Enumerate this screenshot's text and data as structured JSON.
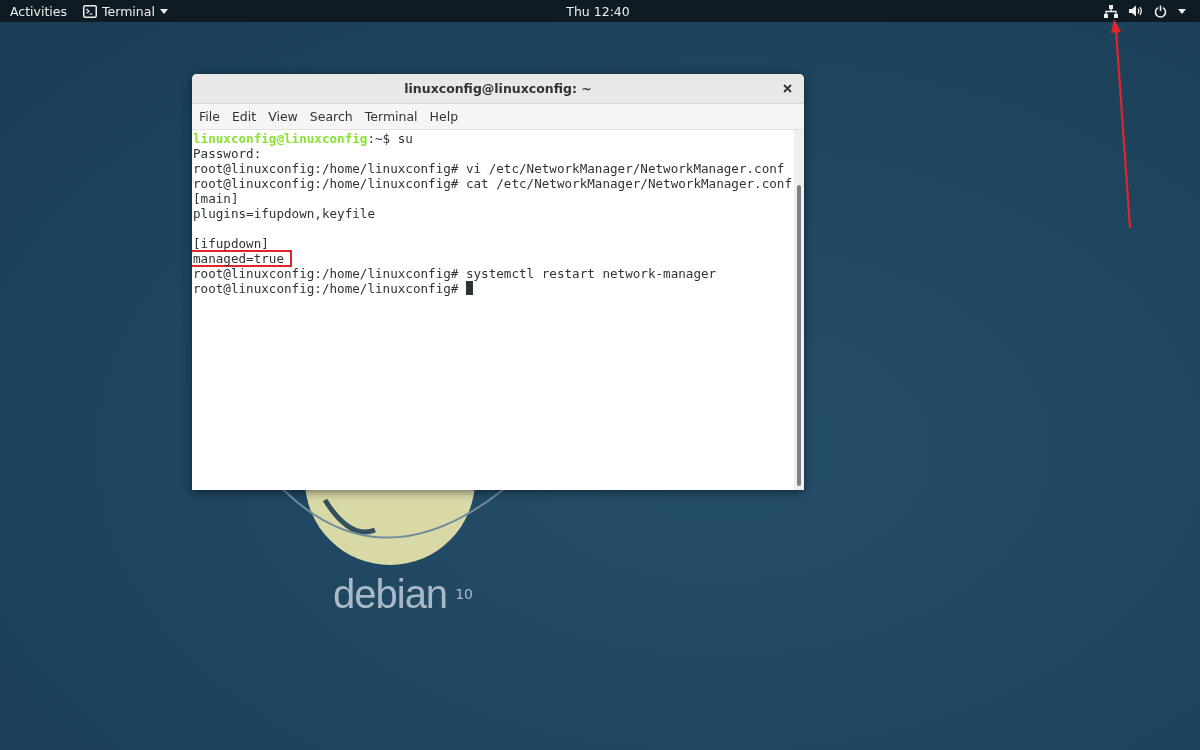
{
  "top_bar": {
    "activities": "Activities",
    "app_menu": "Terminal",
    "clock": "Thu 12:40"
  },
  "desktop": {
    "logo_text": "debian",
    "logo_version": "10"
  },
  "terminal": {
    "title": "linuxconfig@linuxconfig: ~",
    "menu": [
      "File",
      "Edit",
      "View",
      "Search",
      "Terminal",
      "Help"
    ],
    "lines": [
      {
        "kind": "user_prompt",
        "user": "linuxconfig@linuxconfig",
        "text": ":~$ su",
        "highlighted": false,
        "cursor": false
      },
      {
        "kind": "plain",
        "text": "Password:",
        "highlighted": false,
        "cursor": false
      },
      {
        "kind": "plain",
        "text": "root@linuxconfig:/home/linuxconfig# vi /etc/NetworkManager/NetworkManager.conf",
        "highlighted": false,
        "cursor": false
      },
      {
        "kind": "plain",
        "text": "root@linuxconfig:/home/linuxconfig# cat /etc/NetworkManager/NetworkManager.conf",
        "highlighted": false,
        "cursor": false
      },
      {
        "kind": "plain",
        "text": "[main]",
        "highlighted": false,
        "cursor": false
      },
      {
        "kind": "plain",
        "text": "plugins=ifupdown,keyfile",
        "highlighted": false,
        "cursor": false
      },
      {
        "kind": "blank"
      },
      {
        "kind": "plain",
        "text": "[ifupdown]",
        "highlighted": false,
        "cursor": false
      },
      {
        "kind": "plain",
        "text": "managed=true",
        "highlighted": true,
        "cursor": false
      },
      {
        "kind": "plain",
        "text": "root@linuxconfig:/home/linuxconfig# systemctl restart network-manager",
        "highlighted": false,
        "cursor": false
      },
      {
        "kind": "plain",
        "text": "root@linuxconfig:/home/linuxconfig#",
        "highlighted": false,
        "cursor": true
      }
    ]
  }
}
